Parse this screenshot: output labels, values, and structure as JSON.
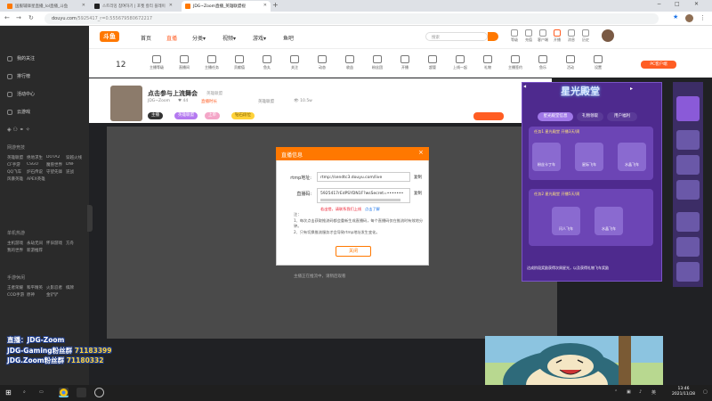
{
  "browser": {
    "tabs": [
      {
        "title": "国服辅锋星直播_lol直播_斗鱼"
      },
      {
        "title": "스트리밍 참여하기 | 포켓 칼리 플레이"
      },
      {
        "title": "바이두 검색 : JDG 검색 결과"
      },
      {
        "title": "JDG~Zoom直播_英雄联盟视"
      }
    ],
    "new_tab": "+",
    "url_host": "douyu.com",
    "url_path": "/5925417_r=0.555679580672217",
    "window_controls": [
      "−",
      "□",
      "✕"
    ]
  },
  "sidebar": {
    "top_items": [
      {
        "label": "我的关注"
      },
      {
        "label": "排行榜"
      },
      {
        "label": "活动中心"
      },
      {
        "label": "云游戏"
      }
    ],
    "sections": [
      {
        "title": "网游竞技",
        "items": [
          "英雄联盟",
          "绝地求生",
          "DOTA2",
          "穿越火线",
          "CF手游",
          "CSGO",
          "魔兽世界",
          "DNF",
          "QQ飞车",
          "炉石传说",
          "守望先锋",
          "逆战",
          "风暴英雄",
          "APEX英雄"
        ]
      },
      {
        "title": "单机热游",
        "items": [
          "主机游戏",
          "永劫无间",
          "怀旧游戏",
          "方舟",
          "我的世界",
          "新游推荐"
        ]
      },
      {
        "title": "手游休闲",
        "items": [
          "王者荣耀",
          "和平精英",
          "火影忍者",
          "棋牌",
          "COD手游",
          "原神",
          "金铲铲"
        ]
      }
    ]
  },
  "header": {
    "logo": "斗鱼",
    "nav": [
      {
        "label": "首页",
        "active": false
      },
      {
        "label": "直播",
        "active": true
      },
      {
        "label": "分类▾",
        "active": false
      },
      {
        "label": "视频▾",
        "active": false
      },
      {
        "label": "游戏▾",
        "active": false
      },
      {
        "label": "鱼吧",
        "active": false
      }
    ],
    "search_placeholder": "搜索",
    "icons": [
      {
        "label": "等级",
        "icon": "level-icon"
      },
      {
        "label": "充值",
        "icon": "recharge-icon"
      },
      {
        "label": "客户端",
        "icon": "client-icon"
      },
      {
        "label": "开播",
        "icon": "broadcast-icon"
      },
      {
        "label": "消息",
        "icon": "message-icon"
      },
      {
        "label": "历史",
        "icon": "history-icon"
      },
      {
        "label": "关注",
        "icon": "follow-icon"
      }
    ]
  },
  "categories": {
    "level_num": "12",
    "items": [
      "主播等级",
      "直播间",
      "主播任务",
      "贡献值",
      "鱼丸",
      "关注",
      "动态",
      "收益",
      "粉丝团",
      "开播",
      "超管",
      "上线一起",
      "礼物",
      "主播签约",
      "鱼乐",
      "活动",
      "设置"
    ],
    "pc_button": "PC客户端"
  },
  "room": {
    "title": "点击参与上流舞会",
    "category": "英雄联盟",
    "meta": [
      {
        "text": "JDG~Zoom"
      },
      {
        "text": "44"
      },
      {
        "text": "直播时长"
      },
      {
        "text": "英雄联盟"
      },
      {
        "text": "10.5w"
      }
    ],
    "tags": [
      {
        "text": "主播"
      },
      {
        "text": "英雄联盟"
      },
      {
        "text": "上单"
      },
      {
        "text": "钻石段位"
      }
    ],
    "vid_note": "主播正在推流中，请稍后观看"
  },
  "modal": {
    "title": "直播信息",
    "close": "×",
    "rtmp_label": "rtmp地址:",
    "rtmp_value": "rtmp://sendtc3.douyu.com/live",
    "code_label": "直播码:",
    "code_value": "5925417rEdPSYDN1F?wsSecret=•••••••",
    "copy": "复制",
    "warn": "若出错，请联系我们上线",
    "warn_link": "点击了解",
    "notes": [
      "注：",
      "1、每次点击获取推流码都会重新生成直播码，每个直播码仅在推流时有效地分钟。",
      "2、只有切换推流服务才会导致rtmp地址发生变化。"
    ],
    "button": "关闭"
  },
  "event": {
    "title": "星光殿堂",
    "tabs": [
      "星光殿堂信息",
      "礼物领取",
      "用户福利"
    ],
    "card1_title": "任务1 星光殿堂 开播3天/周",
    "card1_items": [
      "粉丝卡丁车",
      "星际飞车",
      "水晶飞车"
    ],
    "card2_title": "任务2 星光殿堂 开播5天/周",
    "card2_items": [
      "闪人飞车",
      "水晶飞车"
    ],
    "footer": "达成阶段奖励获得次周星光，以及获得礼物飞车奖励"
  },
  "overlay": {
    "line1": "直播：JDG-Zoom",
    "line2_label": "JDG-Gaming粉丝群",
    "line2_num": "71183399",
    "line3_label": "JDG.Zoom粉丝群",
    "line3_num": "71180332"
  },
  "taskbar": {
    "time": "13:46",
    "date": "2021/11/28"
  }
}
